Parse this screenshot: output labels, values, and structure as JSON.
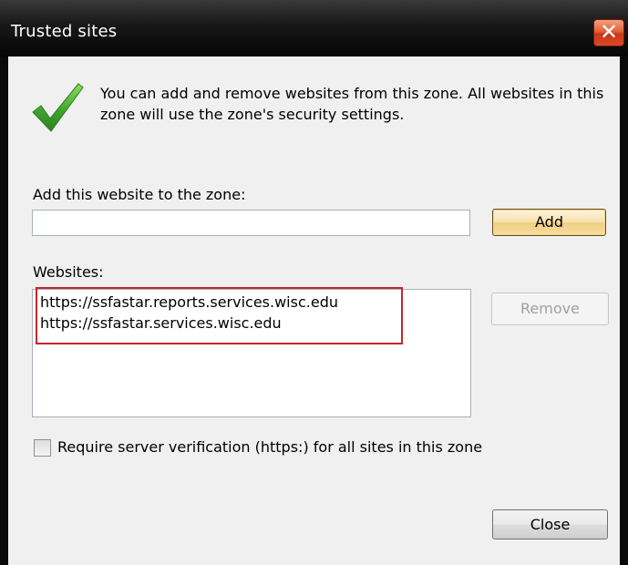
{
  "window": {
    "title": "Trusted sites",
    "close_glyph": "✕"
  },
  "intro": {
    "text": "You can add and remove websites from this zone. All websites in this zone will use the zone's security settings.",
    "icon": "green-checkmark-icon"
  },
  "add_site": {
    "label": "Add this website to the zone:",
    "value": "",
    "button_label": "Add"
  },
  "websites": {
    "label": "Websites:",
    "items": [
      "https://ssfastar.reports.services.wisc.edu",
      "https://ssfastar.services.wisc.edu"
    ],
    "remove_label": "Remove"
  },
  "verification": {
    "label": "Require server verification (https:) for all sites in this zone",
    "checked": false
  },
  "footer": {
    "close_label": "Close"
  },
  "colors": {
    "highlight_border": "#c4272c",
    "close_button_red": "#d84a28",
    "check_green": "#3fa62f"
  }
}
